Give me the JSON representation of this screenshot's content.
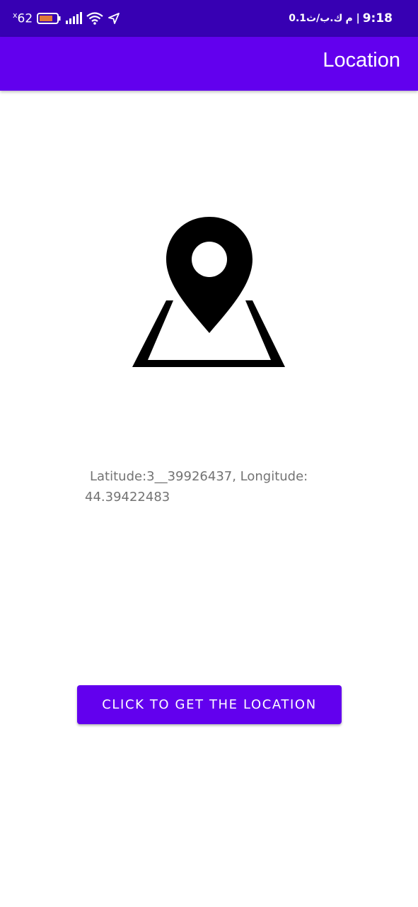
{
  "status_bar": {
    "battery_prefix": "x",
    "battery_level": "62",
    "net_speed": "0.1ك.ب/ث",
    "separator": "م |",
    "time": "9:18",
    "background": "#3700b3"
  },
  "app_bar": {
    "title": "Location",
    "background": "#6200ee"
  },
  "main": {
    "icon": "location-map-icon",
    "location_text": "Latitude:3__39926437, Longitude: 44.39422483"
  },
  "button": {
    "label": "CLICK TO GET THE LOCATION",
    "color": "#6200ee"
  }
}
